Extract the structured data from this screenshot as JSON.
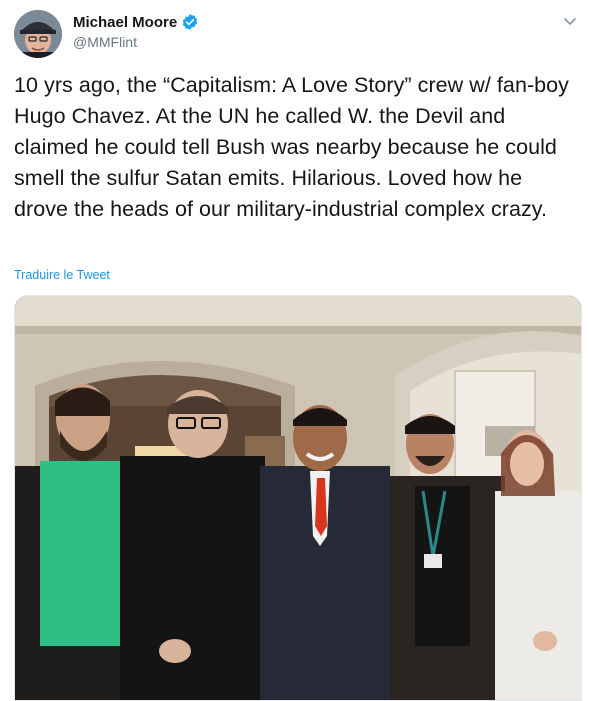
{
  "author": {
    "display_name": "Michael Moore",
    "handle": "@MMFlint",
    "verified": true
  },
  "tweet": {
    "text": "10 yrs ago, the “Capitalism: A Love Story” crew w/ fan-boy Hugo Chavez. At the UN he called W. the Devil and claimed he could tell Bush was nearby because he could smell the sulfur Satan emits. Hilarious. Loved how he drove the heads of our military-industrial complex crazy.",
    "translate_link": "Traduire le Tweet"
  },
  "icons": {
    "verified": "verified-badge-icon",
    "menu": "chevron-down-icon"
  },
  "colors": {
    "link": "#1b95e0",
    "verified": "#1da1f2",
    "text": "#14171a",
    "secondary": "#657786"
  }
}
